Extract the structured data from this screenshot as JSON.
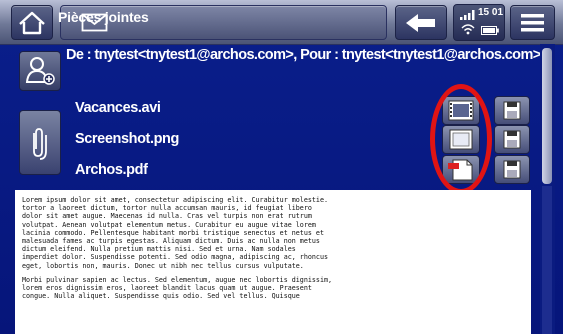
{
  "header": {
    "title": "Pièces jointes",
    "clock": "15 01"
  },
  "message": {
    "from_line": "De : tnytest<tnytest1@archos.com>, Pour : tnytest<tnytest1@archos.com>"
  },
  "attachments": [
    {
      "name": "Vacances.avi",
      "type_icon": "video-file-icon"
    },
    {
      "name": "Screenshot.png",
      "type_icon": "image-file-icon"
    },
    {
      "name": "Archos.pdf",
      "type_icon": "pdf-file-icon"
    }
  ],
  "body": {
    "paragraphs": [
      "Lorem ipsum dolor sit amet, consectetur adipiscing elit. Curabitur molestie.\ntortor a laoreet dictum, tortor nulla accumsan mauris, id feugiat libero\ndolor sit amet augue. Maecenas id nulla. Cras vel turpis non erat rutrum\nvolutpat. Aenean volutpat elementum metus. Curabitur eu augue vitae lorem\nlacinia commodo. Pellentesque habitant morbi tristique senectus et netus et\nmalesuada fames ac turpis egestas. Aliquam dictum. Duis ac nulla non metus\ndictum eleifend. Nulla pretium mattis nisi. Sed et urna. Nam sodales\nimperdiet dolor. Suspendisse potenti. Sed odio magna, adipiscing ac, rhoncus\neget, lobortis non, mauris. Donec ut nibh nec tellus cursus vulputate.",
      "Morbi pulvinar sapien ac lectus. Sed elementum, augue nec lobortis dignissim,\nlorem eros dignissim eros, laoreet blandit lacus quam ut augue. Praesent\ncongue. Nulla aliquet. Suspendisse quis odio. Sed vel tellus. Quisque"
    ]
  },
  "colors": {
    "background": "#0a1f8c",
    "highlight": "#e01414"
  }
}
